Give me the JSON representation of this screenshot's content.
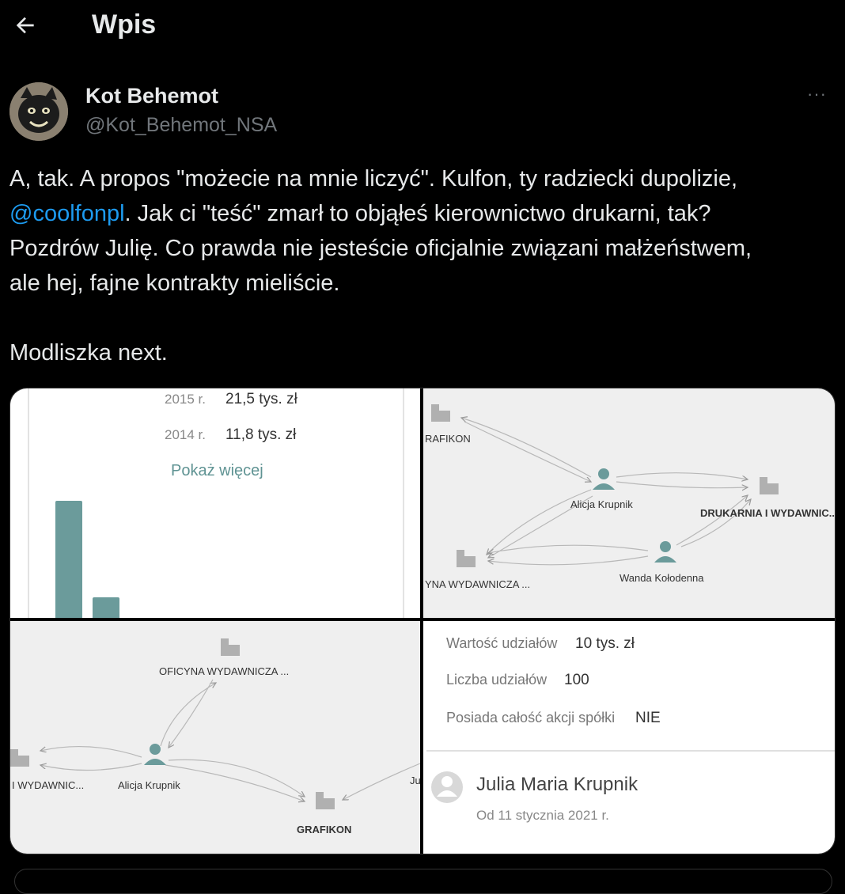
{
  "header": {
    "title": "Wpis"
  },
  "post": {
    "author_name": "Kot Behemot",
    "author_handle": "@Kot_Behemot_NSA",
    "more": "···",
    "line1": "A, tak. A propos \"możecie na mnie liczyć\". Kulfon, ty radziecki dupolizie,",
    "mention": "@coolfonpl",
    "line2_rest": ". Jak ci \"teść\" zmarł to objąłeś kierownictwo drukarni, tak?",
    "line3": "Pozdrów Julię. Co prawda nie jesteście oficjalnie związani małżeństwem,",
    "line4": "ale hej, fajne kontrakty mieliście.",
    "line5": "Modliszka next."
  },
  "media": {
    "img1": {
      "rows": [
        {
          "year": "2015 r.",
          "value": "21,5 tys. zł"
        },
        {
          "year": "2014 r.",
          "value": "11,8 tys. zł"
        }
      ],
      "show_more": "Pokaż więcej",
      "bar_color": "#6b9b9b"
    },
    "img2": {
      "nodes": {
        "grafikon": "RAFIKON",
        "alicja": "Alicja Krupnik",
        "drukarnia": "DRUKARNIA I WYDAWNIC...",
        "oficyna": "YNA WYDAWNICZA ...",
        "wanda": "Wanda Kołodenna"
      }
    },
    "img3": {
      "nodes": {
        "oficyna": "OFICYNA WYDAWNICZA ...",
        "drukarnia": "I WYDAWNIC...",
        "alicja": "Alicja Krupnik",
        "grafikon": "GRAFIKON",
        "cut": "Ju"
      }
    },
    "img4": {
      "shares_value_label": "Wartość udziałów",
      "shares_value": "10 tys. zł",
      "shares_count_label": "Liczba udziałów",
      "shares_count": "100",
      "owns_all_label": "Posiada całość akcji spółki",
      "owns_all": "NIE",
      "person_name": "Julia Maria Krupnik",
      "person_since": "Od 11 stycznia 2021 r."
    },
    "accent": "#6b9b9b"
  }
}
